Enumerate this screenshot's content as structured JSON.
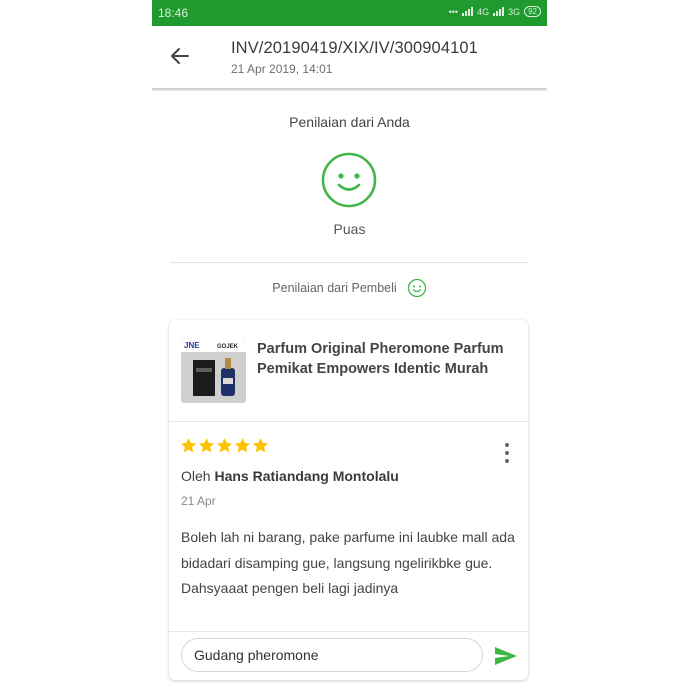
{
  "status_bar": {
    "time": "18:46",
    "network_1": "4G",
    "network_2": "3G",
    "battery": "92"
  },
  "header": {
    "title": "INV/20190419/XIX/IV/300904101",
    "subtitle": "21 Apr 2019, 14:01"
  },
  "seller_rating": {
    "title": "Penilaian dari Anda",
    "label": "Puas"
  },
  "buyer_rating": {
    "title": "Penilaian dari Pembeli"
  },
  "review": {
    "product_title": "Parfum Original Pheromone Parfum Pemikat Empowers Identic Murah",
    "rating": 5,
    "author_prefix": "Oleh",
    "author": "Hans Ratiandang Montolalu",
    "date": "21 Apr",
    "text": "Boleh lah ni barang, pake parfume ini laubke mall ada bidadari disamping gue, langsung ngelirikbke gue. Dahsyaaat pengen beli lagi jadinya",
    "thumb_logo_1": "JNE",
    "thumb_logo_2": "GOJEK"
  },
  "reply": {
    "value": "Gudang pheromone"
  },
  "colors": {
    "brand": "#1e9a2e",
    "accent": "#42b549",
    "star": "#fdc200"
  },
  "icons": {
    "back": "arrow-left-icon",
    "face": "smiley-face-icon",
    "more": "kebab-menu-icon",
    "send": "send-icon"
  }
}
